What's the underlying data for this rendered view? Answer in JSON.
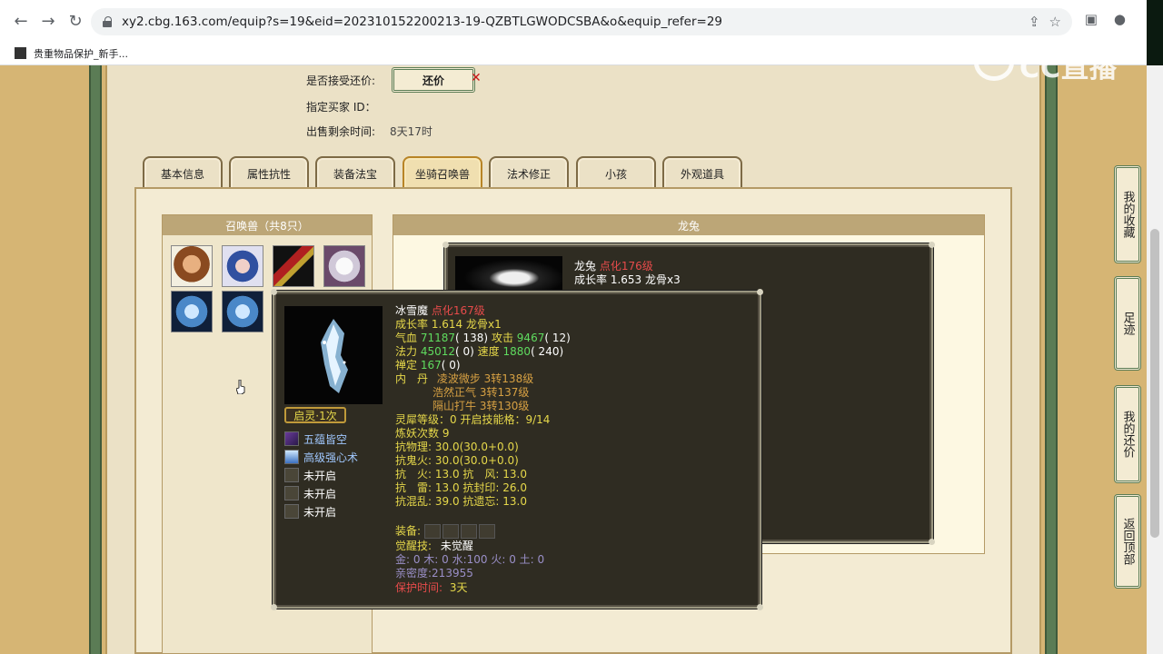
{
  "browser": {
    "url": "xy2.cbg.163.com/equip?s=19&eid=202310152200213-19-QZBTLGWODCSBA&o&equip_refer=29",
    "bookmark_label": "贵重物品保护_新手..."
  },
  "watermark": "CC直播",
  "trade": {
    "accept_counter_label": "是否接受还价:",
    "counter_button": "还价",
    "buyer_id_label": "指定买家 ID：",
    "remaining_label": "出售剩余时间:",
    "remaining_value": "8天17时"
  },
  "tabs": [
    "基本信息",
    "属性抗性",
    "装备法宝",
    "坐骑召唤兽",
    "法术修正",
    "小孩",
    "外观道具"
  ],
  "summon_list": {
    "title": "召唤兽（共8只）"
  },
  "detail": {
    "header": "龙兔",
    "name": "龙兔",
    "level": "点化176级",
    "growth": "成长率 1.653 龙骨x3"
  },
  "tooltip": {
    "name": "冰雪魔",
    "level": "点化167级",
    "growth": "成长率 1.614 龙骨x1",
    "hp_label": "气血",
    "hp_value": "71187",
    "hp_bonus": "( 138)",
    "atk_label": "攻击",
    "atk_value": "9467",
    "atk_bonus": "( 12)",
    "mp_label": "法力",
    "mp_value": "45012",
    "mp_bonus": "( 0)",
    "spd_label": "速度",
    "spd_value": "1880",
    "spd_bonus": "( 240)",
    "ding_label": "禅定",
    "ding_value": "167",
    "ding_bonus": "( 0)",
    "neidan_label": "内　丹",
    "neidan": [
      "凌波微步 3转138级",
      "浩然正气 3转137级",
      "隔山打牛 3转130级"
    ],
    "lingxi": "灵犀等级：0 开启技能格：9/14",
    "lianyao": "炼妖次数 9",
    "resist": [
      "抗物理: 30.0(30.0+0.0)",
      "抗鬼火: 30.0(30.0+0.0)",
      "抗　火: 13.0 抗　风: 13.0",
      "抗　雷: 13.0 抗封印: 26.0",
      "抗混乱: 39.0 抗遗忘: 13.0"
    ],
    "equip_label": "装备:",
    "awaken_label": "觉醒技:",
    "awaken_value": "未觉醒",
    "elements": "金: 0 木: 0 水:100 火: 0 土: 0",
    "intimacy": "亲密度:213955",
    "protect_label": "保护时间:",
    "protect_value": "3天",
    "badge": "启灵·1次",
    "skills": [
      "五蕴皆空",
      "高级强心术",
      "未开启",
      "未开启",
      "未开启"
    ]
  },
  "side_buttons": [
    "我的收藏",
    "足迹",
    "我的还价",
    "返回顶部"
  ]
}
